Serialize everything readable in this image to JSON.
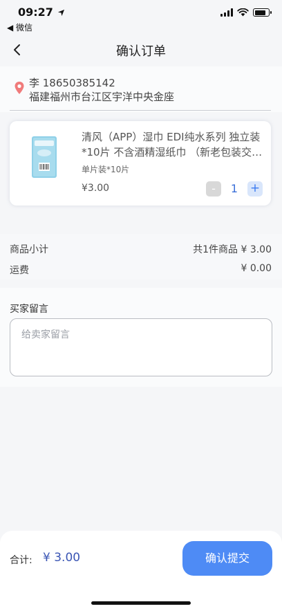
{
  "status_bar": {
    "time": "09:27",
    "back_app": "◀ 微信"
  },
  "nav": {
    "title": "确认订单"
  },
  "address": {
    "contact": "李 18650385142",
    "detail": "福建福州市台江区宇洋中央金座"
  },
  "product": {
    "title": "清风（APP）湿巾 EDI纯水系列 独立装*10片 不含酒精湿纸巾 （新老包装交替发货）",
    "spec": "单片装*10片",
    "price": "¥3.00",
    "quantity": "1",
    "minus_label": "-",
    "plus_label": "+"
  },
  "summary": {
    "subtotal_label": "商品小计",
    "subtotal_value": "共1件商品 ¥ 3.00",
    "shipping_label": "运费",
    "shipping_value": "¥ 0.00"
  },
  "message": {
    "label": "买家留言",
    "placeholder": "给卖家留言",
    "value": ""
  },
  "footer": {
    "total_label": "合计:",
    "total_value": "¥ 3.00",
    "submit_label": "确认提交"
  },
  "colors": {
    "accent": "#4e8bf5",
    "price_blue": "#3a55b4",
    "location_pin": "#f07b7b"
  },
  "icons": {
    "back": "chevron-left-icon",
    "location": "location-pin-icon",
    "signal": "cellular-signal-icon",
    "wifi": "wifi-icon",
    "battery": "battery-icon",
    "location_arrow": "location-arrow-icon"
  }
}
